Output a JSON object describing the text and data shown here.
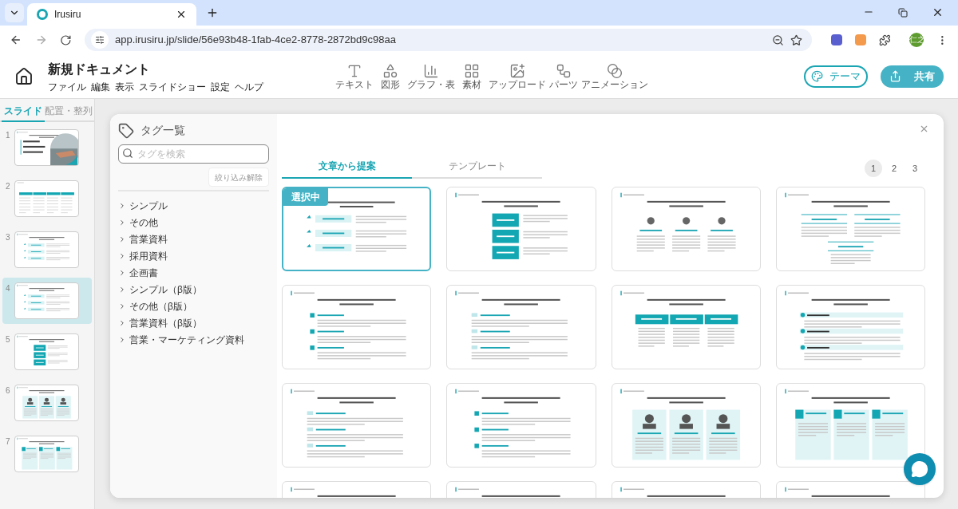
{
  "browser": {
    "tab_title": "Irusiru",
    "url": "app.irusiru.jp/slide/56e93b48-1fab-4ce2-8778-2872bd9c98aa",
    "avatar": "仁之"
  },
  "app": {
    "doc_title": "新規ドキュメント",
    "menu": [
      "ファイル",
      "編集",
      "表示",
      "スライドショー",
      "設定",
      "ヘルプ"
    ],
    "tools": [
      {
        "kind": "text",
        "label": "テキスト"
      },
      {
        "kind": "shape",
        "label": "図形"
      },
      {
        "kind": "chart",
        "label": "グラフ・表"
      },
      {
        "kind": "material",
        "label": "素材"
      },
      {
        "kind": "upload",
        "label": "アップロード"
      },
      {
        "kind": "parts",
        "label": "パーツ"
      },
      {
        "kind": "animation",
        "label": "アニメーション"
      }
    ],
    "theme_button": "テーマ",
    "share_button": "共有"
  },
  "side_tabs": [
    {
      "label": "スライド",
      "selected": true
    },
    {
      "label": "配置・整列",
      "selected": false
    }
  ],
  "slides": [
    {
      "number": "1",
      "kind": "cover",
      "selected": false
    },
    {
      "number": "2",
      "kind": "table",
      "selected": false
    },
    {
      "number": "3",
      "kind": "icon-rows",
      "selected": false
    },
    {
      "number": "4",
      "kind": "icon-rows",
      "selected": true
    },
    {
      "number": "5",
      "kind": "teal-boxes",
      "selected": false
    },
    {
      "number": "6",
      "kind": "figure-columns",
      "selected": false
    },
    {
      "number": "7",
      "kind": "number-cards",
      "selected": false
    }
  ],
  "modal": {
    "title": "タグ一覧",
    "search_placeholder": "タグを検索",
    "clear_button": "絞り込み解除",
    "tags": [
      "シンプル",
      "その他",
      "営業資料",
      "採用資料",
      "企画書",
      "シンプル（β版）",
      "その他（β版）",
      "営業資料（β版）",
      "営業・マーケティング資料"
    ],
    "tabs": [
      {
        "label": "文章から提案",
        "selected": true
      },
      {
        "label": "テンプレート",
        "selected": false
      }
    ],
    "pages": [
      {
        "label": "1",
        "selected": true
      },
      {
        "label": "2",
        "selected": false
      },
      {
        "label": "3",
        "selected": false
      }
    ],
    "badge": "選択中",
    "templates": [
      {
        "kind": "icon-rows",
        "selected": true
      },
      {
        "kind": "teal-boxes",
        "selected": false
      },
      {
        "kind": "icon-columns",
        "selected": false
      },
      {
        "kind": "lined-columns",
        "selected": false
      },
      {
        "kind": "numbered-rows",
        "selected": false
      },
      {
        "kind": "number-rows",
        "selected": false
      },
      {
        "kind": "header-columns",
        "selected": false
      },
      {
        "kind": "dot-bands",
        "selected": false
      },
      {
        "kind": "number-rows",
        "selected": false
      },
      {
        "kind": "numbered-rows",
        "selected": false
      },
      {
        "kind": "figure-columns",
        "selected": false
      },
      {
        "kind": "number-cards",
        "selected": false
      },
      {
        "kind": "plain",
        "selected": false
      },
      {
        "kind": "plain",
        "selected": false
      },
      {
        "kind": "plain",
        "selected": false
      },
      {
        "kind": "plain",
        "selected": false
      }
    ]
  }
}
